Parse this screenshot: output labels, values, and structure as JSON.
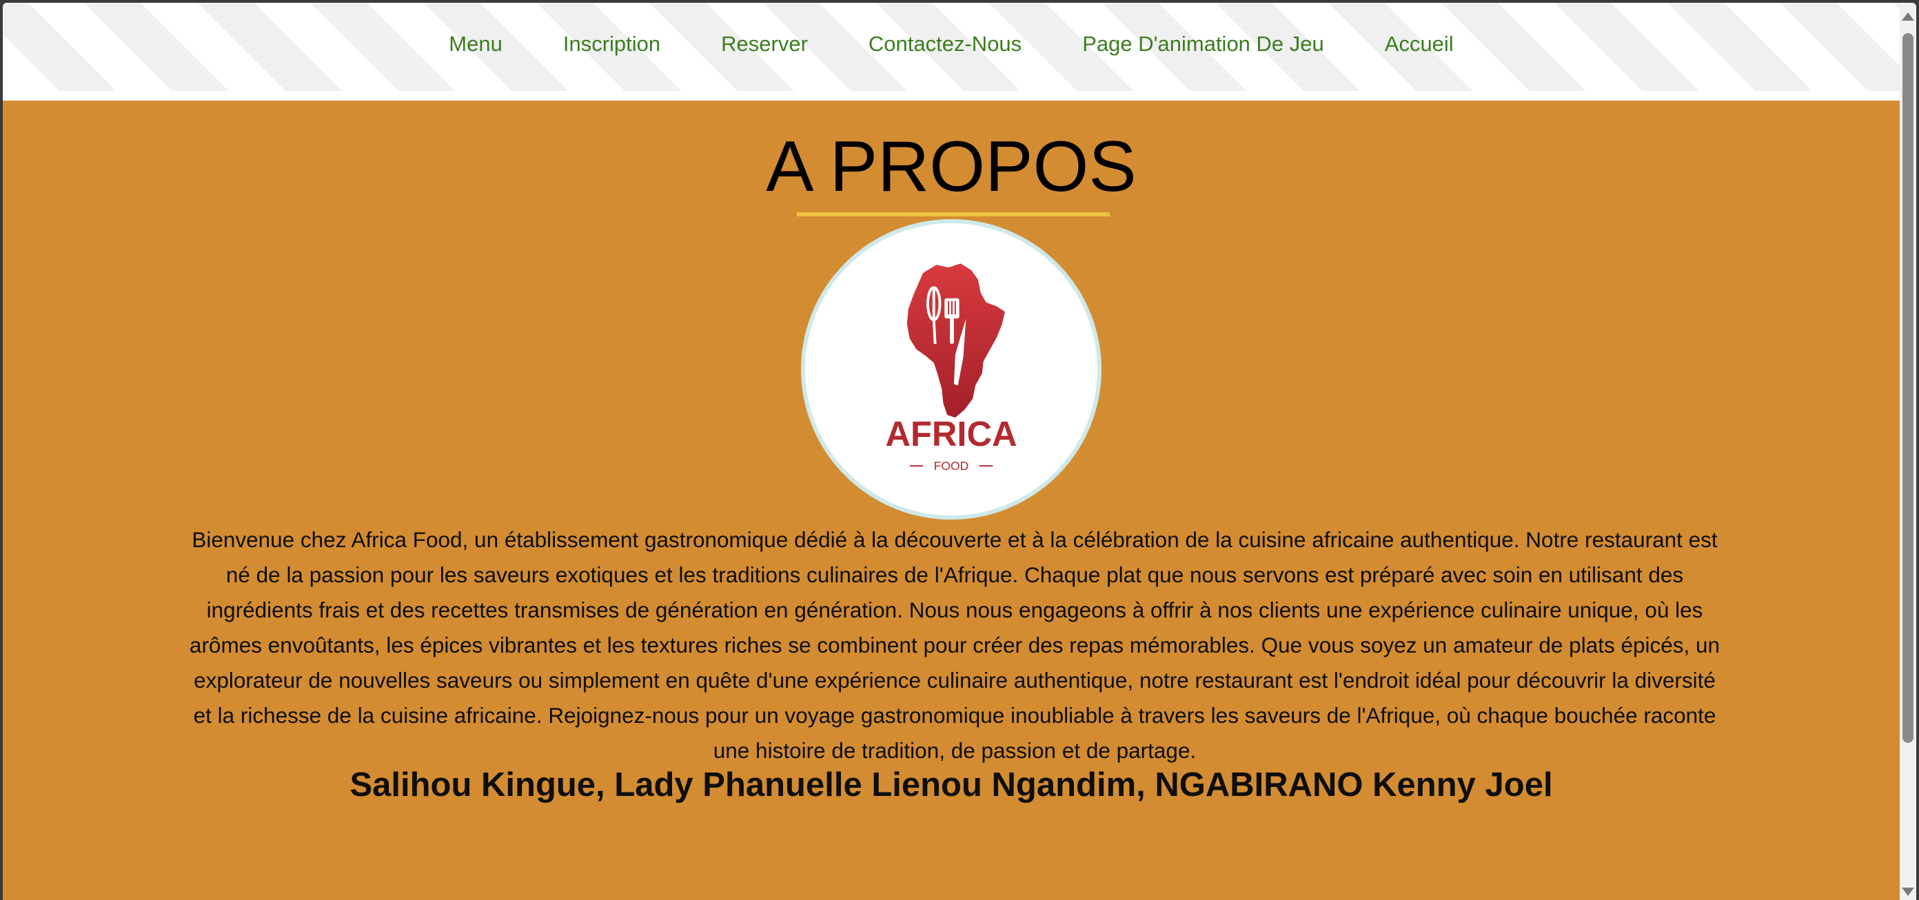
{
  "nav": {
    "items": [
      {
        "label": "Menu"
      },
      {
        "label": "Inscription"
      },
      {
        "label": "Reserver"
      },
      {
        "label": "Contactez-Nous"
      },
      {
        "label": "Page D'animation De Jeu"
      },
      {
        "label": "Accueil"
      }
    ]
  },
  "main": {
    "title": "A PROPOS",
    "logo": {
      "brand": "AFRICA",
      "sub": "FOOD"
    },
    "about_text": "Bienvenue chez Africa Food, un établissement gastronomique dédié à la découverte et à la célébration de la cuisine africaine authentique. Notre restaurant est né de la passion pour les saveurs exotiques et les traditions culinaires de l'Afrique. Chaque plat que nous servons est préparé avec soin en utilisant des ingrédients frais et des recettes transmises de génération en génération. Nous nous engageons à offrir à nos clients une expérience culinaire unique, où les arômes envoûtants, les épices vibrantes et les textures riches se combinent pour créer des repas mémorables. Que vous soyez un amateur de plats épicés, un explorateur de nouvelles saveurs ou simplement en quête d'une expérience culinaire authentique, notre restaurant est l'endroit idéal pour découvrir la diversité et la richesse de la cuisine africaine. Rejoignez-nous pour un voyage gastronomique inoubliable à travers les saveurs de l'Afrique, où chaque bouchée raconte une histoire de tradition, de passion et de partage.",
    "authors": "Salihou Kingue, Lady Phanuelle Lienou Ngandim, NGABIRANO Kenny Joel"
  },
  "colors": {
    "background": "#d38c32",
    "nav_link": "#3b7d1f",
    "title_underline": "#f0c040",
    "logo_red": "#c0282e"
  },
  "icons": {
    "logo": "africa-map-utensils-icon",
    "scroll_up": "triangle-up-icon",
    "scroll_down": "triangle-down-icon"
  }
}
